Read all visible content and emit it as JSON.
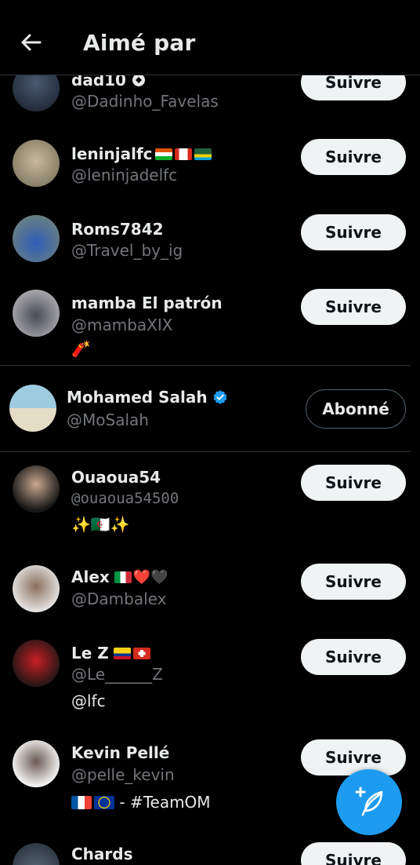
{
  "header": {
    "title": "Aimé par"
  },
  "users": [
    {
      "name": "dad10",
      "handle": "@Dadinho_Favelas",
      "bio": "",
      "button": "Suivre"
    },
    {
      "name": "leninjalfc",
      "handle": "@leninjadelfc",
      "bio": "",
      "button": "Suivre"
    },
    {
      "name": "Roms7842",
      "handle": "@Travel_by_ig",
      "bio": "",
      "button": "Suivre"
    },
    {
      "name": "mamba El patrón",
      "handle": "@mambaXIX",
      "bio": "🧨",
      "button": "Suivre"
    },
    {
      "name": "Mohamed Salah",
      "handle": "@MoSalah",
      "bio": "",
      "button": "Abonné"
    },
    {
      "name": "Ouaoua54",
      "handle": "@ouaoua54500",
      "bio": "✨🇩🇿✨",
      "button": "Suivre"
    },
    {
      "name": "Alex",
      "handle": "@Dambalex",
      "bio": "",
      "button": "Suivre"
    },
    {
      "name": "Le Z",
      "handle": "@Le______Z",
      "bio": "@lfc",
      "button": "Suivre"
    },
    {
      "name": "Kevin Pellé",
      "handle": "@pelle_kevin",
      "bio": " - #TeamOM",
      "button": "Suivre"
    },
    {
      "name": "Chards",
      "handle": "",
      "bio": "",
      "button": "Suivre"
    }
  ],
  "emojis": {
    "alex_hearts": "❤️🖤"
  },
  "colors": {
    "accent": "#1d9bf0",
    "background": "#000000",
    "secondary_text": "#71767b"
  }
}
